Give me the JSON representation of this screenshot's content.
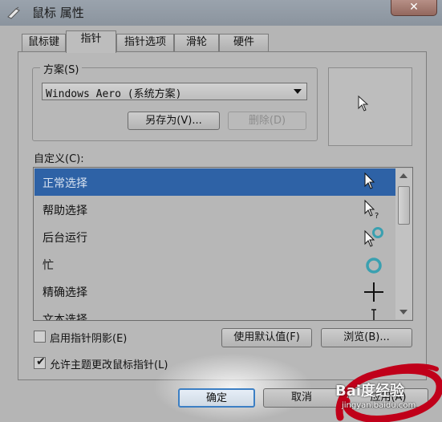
{
  "window": {
    "title": "鼠标 属性",
    "close_label": "✕"
  },
  "tabs": [
    {
      "label": "鼠标键"
    },
    {
      "label": "指针"
    },
    {
      "label": "指针选项"
    },
    {
      "label": "滑轮"
    },
    {
      "label": "硬件"
    }
  ],
  "active_tab": "指针",
  "scheme": {
    "group_label": "方案(S)",
    "selected": "Windows Aero (系统方案)",
    "save_as_label": "另存为(V)...",
    "delete_label": "删除(D)"
  },
  "custom": {
    "label": "自定义(C):",
    "items": [
      {
        "label": "正常选择",
        "icon": "normal-select-cursor",
        "selected": true
      },
      {
        "label": "帮助选择",
        "icon": "help-select-cursor"
      },
      {
        "label": "后台运行",
        "icon": "working-in-background-cursor"
      },
      {
        "label": "忙",
        "icon": "busy-cursor"
      },
      {
        "label": "精确选择",
        "icon": "precision-select-cursor"
      },
      {
        "label": "文本选择",
        "icon": "text-select-cursor"
      }
    ]
  },
  "options": {
    "shadow_label": "启用指针阴影(E)",
    "shadow_checked": false,
    "theme_label": "允许主题更改鼠标指针(L)",
    "theme_checked": true,
    "default_label": "使用默认值(F)",
    "browse_label": "浏览(B)..."
  },
  "footer": {
    "ok_label": "确定",
    "cancel_label": "取消",
    "apply_label": "应用(A)"
  },
  "watermark": {
    "brand": "Bai度经验",
    "url": "jingyan.baidu.com"
  },
  "colors": {
    "selection": "#2e62a6",
    "scribble": "#c0001a"
  }
}
